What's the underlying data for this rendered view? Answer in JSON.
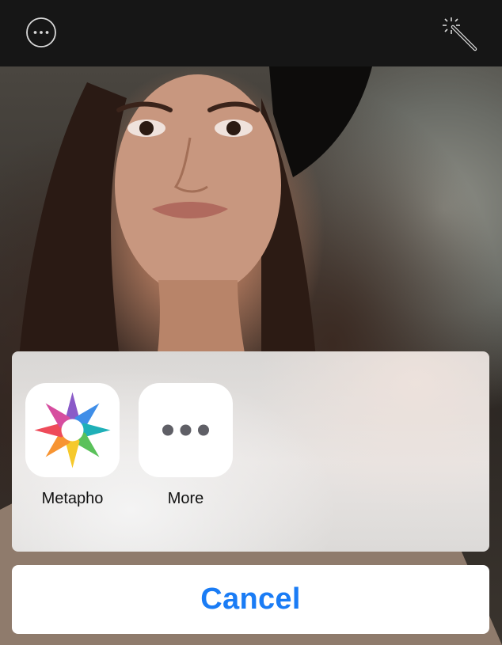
{
  "toolbar": {
    "left_icon": "more-circle-icon",
    "right_icon": "magic-wand-icon"
  },
  "photo": {
    "subject": "woman-portrait-photo"
  },
  "share_sheet": {
    "apps": [
      {
        "label": "Metapho",
        "icon": "metapho-app-icon"
      },
      {
        "label": "More",
        "icon": "more-dots-icon"
      }
    ],
    "cancel_label": "Cancel"
  },
  "colors": {
    "accent": "#1a7cf5",
    "toolbar_bg": "#161616",
    "sheet_bg": "#e2e0de",
    "button_bg": "#ffffff"
  }
}
